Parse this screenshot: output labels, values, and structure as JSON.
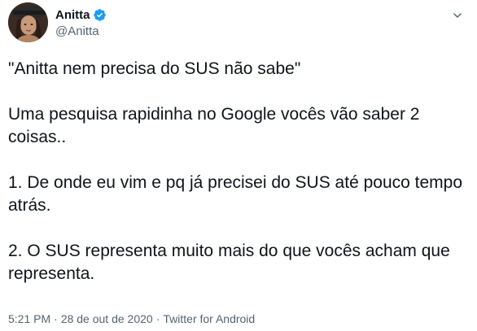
{
  "author": {
    "display_name": "Anitta",
    "handle": "@Anitta",
    "verified": true
  },
  "tweet": {
    "paragraphs": [
      "\"Anitta nem precisa do SUS não sabe\"",
      "Uma pesquisa rapidinha no Google vocês vão saber 2 coisas..",
      "1. De onde eu vim e pq já precisei do SUS até pouco tempo atrás.",
      "2. O SUS representa muito mais do que vocês acham que representa."
    ]
  },
  "meta": {
    "time": "5:21 PM",
    "separator": "·",
    "date": "28 de out de 2020",
    "source": "Twitter for Android"
  },
  "colors": {
    "verified_badge": "#1d9bf0",
    "secondary_text": "#536471",
    "primary_text": "#0f1419"
  },
  "icons": {
    "verified": "verified-badge-icon",
    "more": "chevron-down-icon"
  }
}
